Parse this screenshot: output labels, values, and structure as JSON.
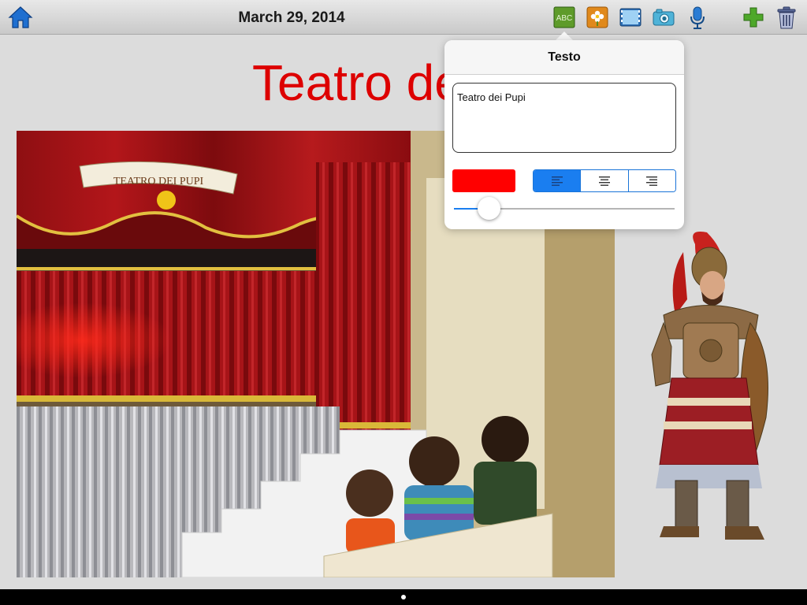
{
  "toolbar": {
    "date": "March 29, 2014",
    "icons": {
      "home": "home-icon",
      "text": "text-abc-icon",
      "image": "image-flower-icon",
      "video": "film-icon",
      "camera": "camera-icon",
      "mic": "microphone-icon",
      "add": "plus-icon",
      "trash": "trash-icon"
    },
    "text_tool_label": "ABC"
  },
  "page": {
    "title": "Teatro dei Pupi",
    "photo_banner": "TEATRO DEI PUPI"
  },
  "popover": {
    "title": "Testo",
    "text_value": "Teatro dei Pupi",
    "color": "#ff0000",
    "align_options": [
      "left",
      "center",
      "right"
    ],
    "align_selected": "left",
    "size_slider_value": 0.12
  },
  "pager": {
    "current": 1,
    "total": 1
  },
  "colors": {
    "accent": "#1a7ef0",
    "title_red": "#dd0000",
    "home_blue": "#1f6fd0",
    "add_green": "#4ea82a"
  }
}
